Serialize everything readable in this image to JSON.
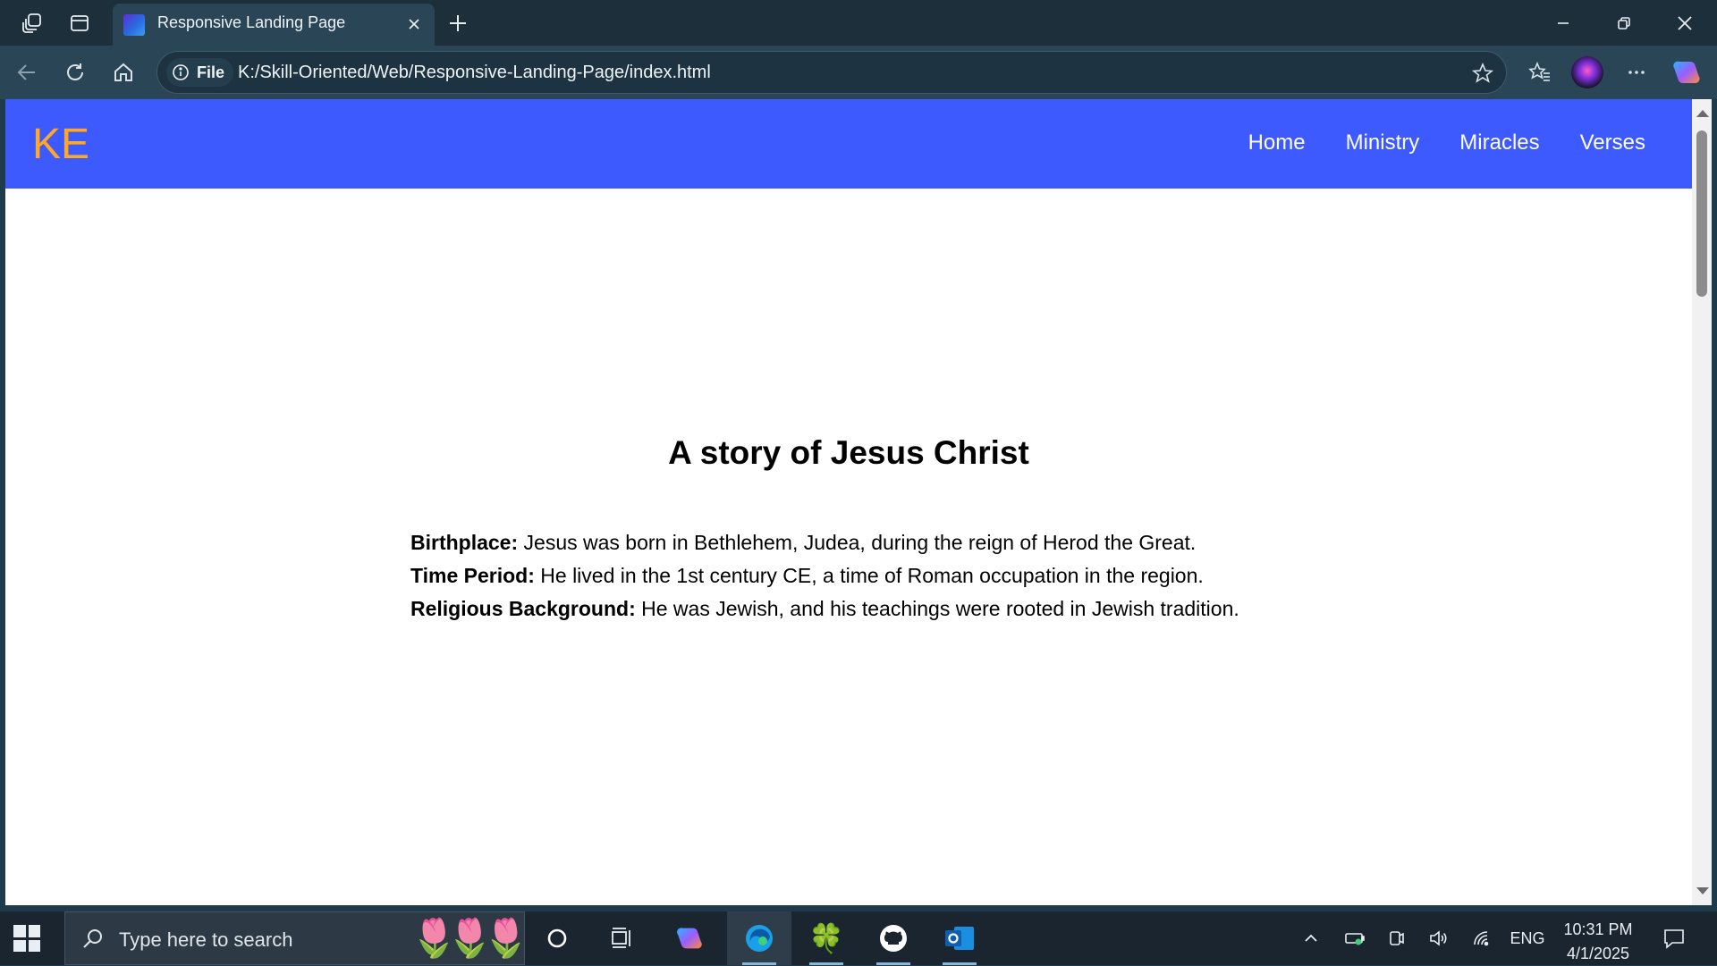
{
  "browser": {
    "tab_title": "Responsive Landing Page",
    "site_info_label": "File",
    "url": "K:/Skill-Oriented/Web/Responsive-Landing-Page/index.html"
  },
  "page": {
    "logo": "KE",
    "nav": [
      {
        "label": "Home"
      },
      {
        "label": "Ministry"
      },
      {
        "label": "Miracles"
      },
      {
        "label": "Verses"
      }
    ],
    "title": "A story of Jesus Christ",
    "facts": [
      {
        "label": "Birthplace:",
        "text": " Jesus was born in Bethlehem, Judea, during the reign of Herod the Great."
      },
      {
        "label": "Time Period:",
        "text": " He lived in the 1st century CE, a time of Roman occupation in the region."
      },
      {
        "label": "Religious Background:",
        "text": " He was Jewish, and his teachings were rooted in Jewish tradition."
      }
    ]
  },
  "taskbar": {
    "search_placeholder": "Type here to search",
    "language": "ENG",
    "time": "10:31 PM",
    "date": "4/1/2025"
  },
  "colors": {
    "nav_background": "#3d5afe",
    "logo": "#ffa726",
    "browser_frame": "#2a4556"
  }
}
